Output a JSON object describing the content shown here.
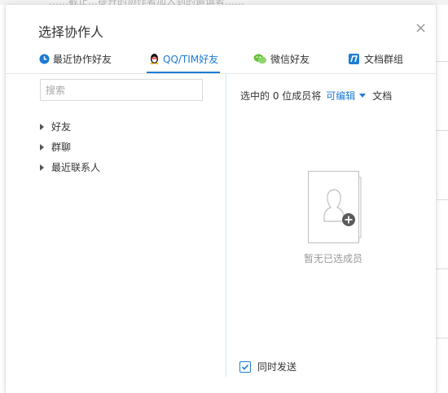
{
  "background": {
    "partial_text": "……截止…提升的协作者加入到的邀请者……"
  },
  "dialog": {
    "title": "选择协作人",
    "close_glyph": "×"
  },
  "tabs": [
    {
      "label": "最近协作好友",
      "icon": "clock-icon",
      "color": "#1e7bd6"
    },
    {
      "label": "QQ/TIM好友",
      "icon": "qq-penguin-icon",
      "active": true
    },
    {
      "label": "微信好友",
      "icon": "wechat-icon",
      "color": "#67c23a"
    },
    {
      "label": "文档群组",
      "icon": "group-doc-icon",
      "color": "#1e7bd6"
    }
  ],
  "left": {
    "search_placeholder": "搜索",
    "tree": [
      "好友",
      "群聊",
      "最近联系人"
    ]
  },
  "right": {
    "summary_prefix": "选中的 0 位成员将",
    "permission": "可编辑",
    "summary_suffix": "文档",
    "empty_text": "暂无已选成员",
    "sync_checkbox_label": "同时发送",
    "sync_checked": true
  },
  "colors": {
    "accent": "#1e7bd6",
    "wechat_green": "#67c23a"
  }
}
